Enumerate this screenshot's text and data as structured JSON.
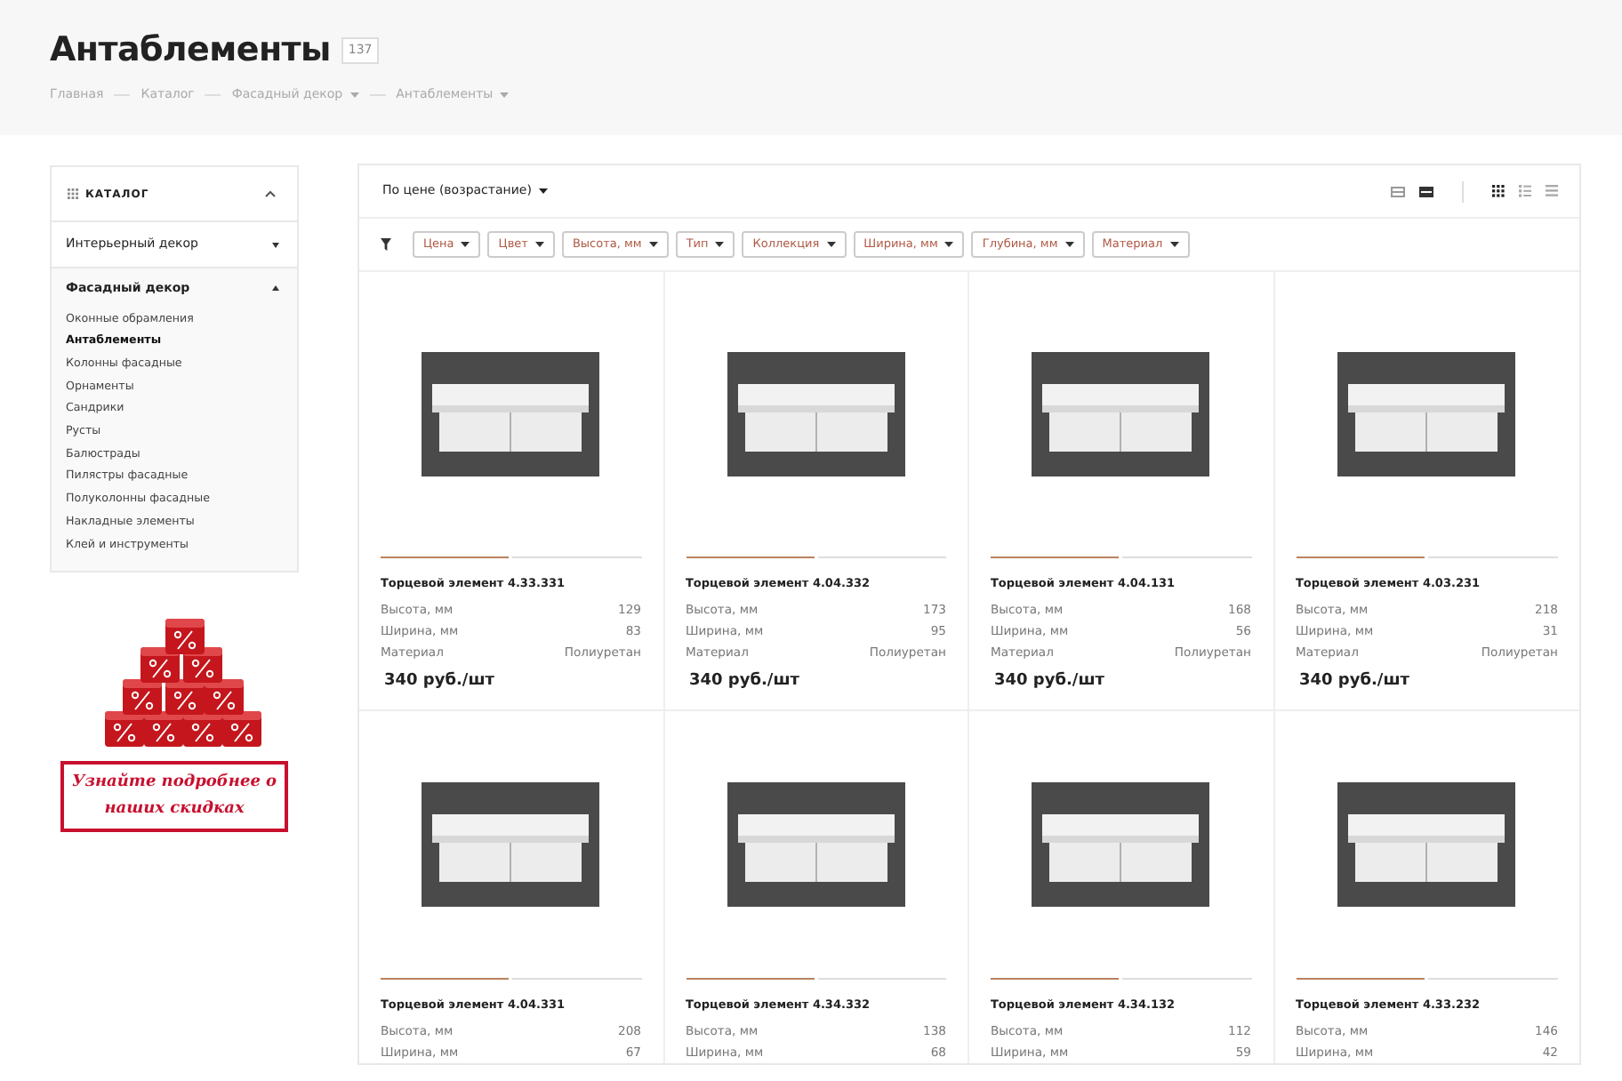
{
  "header": {
    "title": "Антаблементы",
    "count": "137",
    "breadcrumbs": [
      {
        "label": "Главная",
        "dropdown": false
      },
      {
        "label": "Каталог",
        "dropdown": false
      },
      {
        "label": "Фасадный декор",
        "dropdown": true
      },
      {
        "label": "Антаблементы",
        "dropdown": true
      }
    ]
  },
  "sidebar": {
    "title": "КАТАЛОГ",
    "expanded": true,
    "sections": [
      {
        "label": "Интерьерный декор",
        "expanded": false
      },
      {
        "label": "Фасадный декор",
        "expanded": true,
        "children": [
          {
            "label": "Оконные обрамления",
            "selected": false
          },
          {
            "label": "Антаблементы",
            "selected": true
          },
          {
            "label": "Колонны фасадные",
            "selected": false
          },
          {
            "label": "Орнаменты",
            "selected": false
          },
          {
            "label": "Сандрики",
            "selected": false
          },
          {
            "label": "Русты",
            "selected": false
          },
          {
            "label": "Балюстрады",
            "selected": false
          },
          {
            "label": "Пилястры фасадные",
            "selected": false
          },
          {
            "label": "Полуколонны фасадные",
            "selected": false
          },
          {
            "label": "Накладные элементы",
            "selected": false
          },
          {
            "label": "Клей и инструменты",
            "selected": false
          }
        ]
      }
    ],
    "banner": {
      "text": "Узнайте подробнее о наших скидках"
    }
  },
  "toolbar": {
    "sort": "По цене (возрастание)",
    "density": [
      {
        "selected": false
      },
      {
        "selected": true
      }
    ],
    "views": [
      {
        "kind": "grid",
        "selected": true
      },
      {
        "kind": "list",
        "selected": false
      },
      {
        "kind": "table",
        "selected": false
      }
    ]
  },
  "filters": [
    "Цена",
    "Цвет",
    "Высота, мм",
    "Тип",
    "Коллекция",
    "Ширина, мм",
    "Глубина, мм",
    "Материал"
  ],
  "products": [
    {
      "name": "Торцевой элемент 4.33.331",
      "specs": [
        [
          "Высота, мм",
          "129"
        ],
        [
          "Ширина, мм",
          "83"
        ],
        [
          "Материал",
          "Полиуретан"
        ]
      ],
      "price": "340 руб./шт"
    },
    {
      "name": "Торцевой элемент 4.04.332",
      "specs": [
        [
          "Высота, мм",
          "173"
        ],
        [
          "Ширина, мм",
          "95"
        ],
        [
          "Материал",
          "Полиуретан"
        ]
      ],
      "price": "340 руб./шт"
    },
    {
      "name": "Торцевой элемент 4.04.131",
      "specs": [
        [
          "Высота, мм",
          "168"
        ],
        [
          "Ширина, мм",
          "56"
        ],
        [
          "Материал",
          "Полиуретан"
        ]
      ],
      "price": "340 руб./шт"
    },
    {
      "name": "Торцевой элемент 4.03.231",
      "specs": [
        [
          "Высота, мм",
          "218"
        ],
        [
          "Ширина, мм",
          "31"
        ],
        [
          "Материал",
          "Полиуретан"
        ]
      ],
      "price": "340 руб./шт"
    },
    {
      "name": "Торцевой элемент 4.04.331",
      "specs": [
        [
          "Высота, мм",
          "208"
        ],
        [
          "Ширина, мм",
          "67"
        ]
      ]
    },
    {
      "name": "Торцевой элемент 4.34.332",
      "specs": [
        [
          "Высота, мм",
          "138"
        ],
        [
          "Ширина, мм",
          "68"
        ]
      ]
    },
    {
      "name": "Торцевой элемент 4.34.132",
      "specs": [
        [
          "Высота, мм",
          "112"
        ],
        [
          "Ширина, мм",
          "59"
        ]
      ]
    },
    {
      "name": "Торцевой элемент 4.33.232",
      "specs": [
        [
          "Высота, мм",
          "146"
        ],
        [
          "Ширина, мм",
          "42"
        ]
      ]
    }
  ]
}
